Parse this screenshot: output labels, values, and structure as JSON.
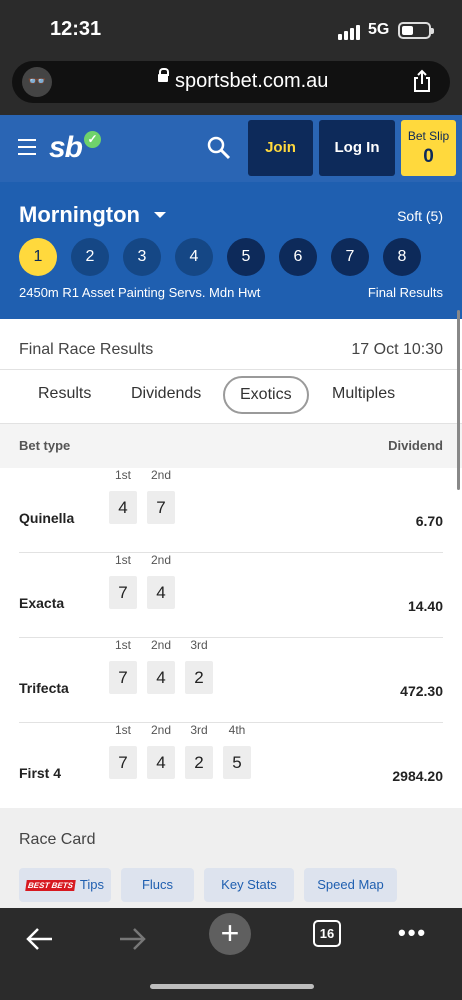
{
  "status": {
    "time": "12:31",
    "network": "5G"
  },
  "browser": {
    "url": "sportsbet.com.au"
  },
  "header": {
    "logo": "sb",
    "join_label": "Join",
    "login_label": "Log In",
    "betslip_label": "Bet Slip",
    "betslip_count": "0"
  },
  "race": {
    "venue": "Mornington",
    "going": "Soft (5)",
    "numbers": [
      "1",
      "2",
      "3",
      "4",
      "5",
      "6",
      "7",
      "8"
    ],
    "active": "1",
    "info": "2450m R1 Asset Painting Servs. Mdn Hwt",
    "status": "Final Results"
  },
  "results": {
    "title": "Final Race Results",
    "date": "17 Oct 10:30",
    "tabs": [
      "Results",
      "Dividends",
      "Exotics",
      "Multiples"
    ],
    "selected_tab": "Exotics",
    "col_bet_type": "Bet type",
    "col_dividend": "Dividend",
    "position_labels": [
      "1st",
      "2nd",
      "3rd",
      "4th"
    ],
    "bets": [
      {
        "name": "Quinella",
        "runners": [
          "4",
          "7"
        ],
        "dividend": "6.70"
      },
      {
        "name": "Exacta",
        "runners": [
          "7",
          "4"
        ],
        "dividend": "14.40"
      },
      {
        "name": "Trifecta",
        "runners": [
          "7",
          "4",
          "2"
        ],
        "dividend": "472.30"
      },
      {
        "name": "First 4",
        "runners": [
          "7",
          "4",
          "2",
          "5"
        ],
        "dividend": "2984.20"
      }
    ]
  },
  "racecard": {
    "title": "Race Card",
    "best_bets_icon_text": "BEST BETS",
    "buttons": [
      "Tips",
      "Flucs",
      "Key Stats",
      "Speed Map"
    ]
  },
  "toolbar": {
    "tab_count": "16",
    "new_tab": "+",
    "more": "•••"
  }
}
